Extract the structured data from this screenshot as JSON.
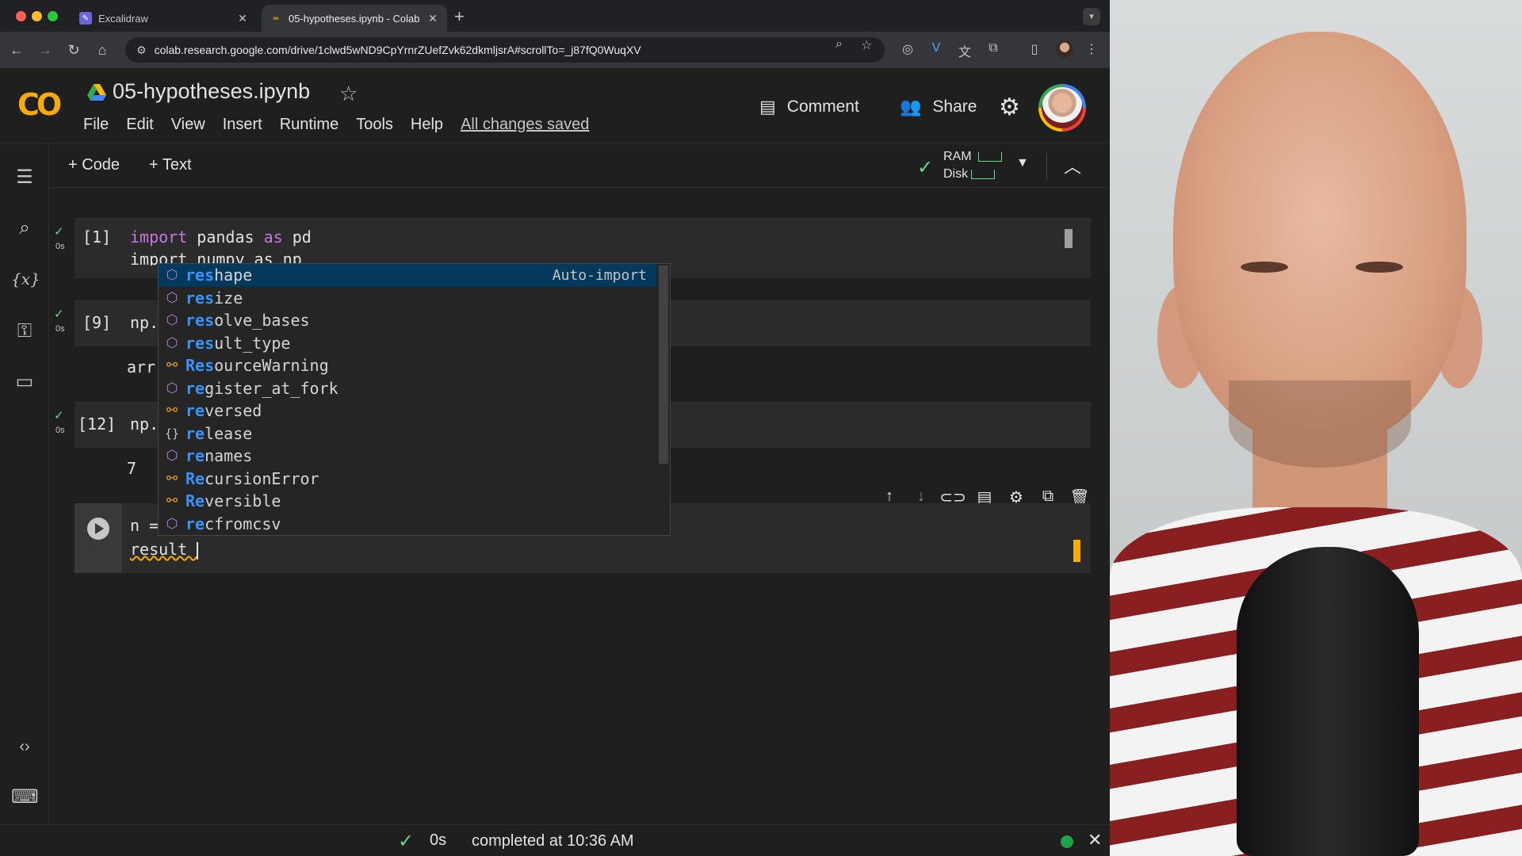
{
  "browser": {
    "tabs": [
      {
        "title": "Excalidraw",
        "active": false
      },
      {
        "title": "05-hypotheses.ipynb - Colab",
        "active": true
      }
    ],
    "url": "colab.research.google.com/drive/1clwd5wND9CpYrnrZUefZvk62dkmljsrA#scrollTo=_j87fQ0WuqXV"
  },
  "header": {
    "logo": "CO",
    "notebook_title": "05-hypotheses.ipynb",
    "menu": [
      "File",
      "Edit",
      "View",
      "Insert",
      "Runtime",
      "Tools",
      "Help"
    ],
    "save_status": "All changes saved",
    "comment_label": "Comment",
    "share_label": "Share"
  },
  "toolbar": {
    "add_code": "+ Code",
    "add_text": "+ Text",
    "ram_label": "RAM",
    "disk_label": "Disk"
  },
  "cells": [
    {
      "count": "[1]",
      "time": "0s",
      "line1_kw1": "import",
      "line1_mid": " pandas ",
      "line1_kw2": "as",
      "line1_end": " pd",
      "line2": "import numpy as np"
    },
    {
      "count": "[9]",
      "time": "0s",
      "code": "np.",
      "output": "arr"
    },
    {
      "count": "[12]",
      "time": "0s",
      "code": "np.",
      "output": "7"
    }
  ],
  "active_cell": {
    "line1": "n =",
    "line2": "result "
  },
  "autocomplete": {
    "detail": "Auto-import",
    "items": [
      {
        "pre": "",
        "hl": "res",
        "post": "hape",
        "kind": "method"
      },
      {
        "pre": "",
        "hl": "res",
        "post": "ize",
        "kind": "method"
      },
      {
        "pre": "",
        "hl": "res",
        "post": "olve_bases",
        "kind": "method"
      },
      {
        "pre": "",
        "hl": "res",
        "post": "ult_type",
        "kind": "method"
      },
      {
        "pre": "",
        "hl": "Res",
        "post": "ourceWarning",
        "kind": "class"
      },
      {
        "pre": "",
        "hl": "re",
        "post": "gister_at_fork",
        "kind": "method"
      },
      {
        "pre": "",
        "hl": "re",
        "post": "versed",
        "kind": "class"
      },
      {
        "pre": "",
        "hl": "re",
        "post": "lease",
        "kind": "namespace"
      },
      {
        "pre": "",
        "hl": "re",
        "post": "names",
        "kind": "method"
      },
      {
        "pre": "",
        "hl": "Re",
        "post": "cursionError",
        "kind": "class"
      },
      {
        "pre": "",
        "hl": "Re",
        "post": "versible",
        "kind": "class"
      },
      {
        "pre": "",
        "hl": "re",
        "post": "cfromcsv",
        "kind": "method"
      }
    ]
  },
  "status": {
    "time": "0s",
    "message": "completed at 10:36 AM"
  },
  "colors": {
    "accent_orange": "#f9ab00",
    "success_green": "#6dd58c",
    "highlight_blue": "#3794ff",
    "keyword_purple": "#c678dd"
  }
}
